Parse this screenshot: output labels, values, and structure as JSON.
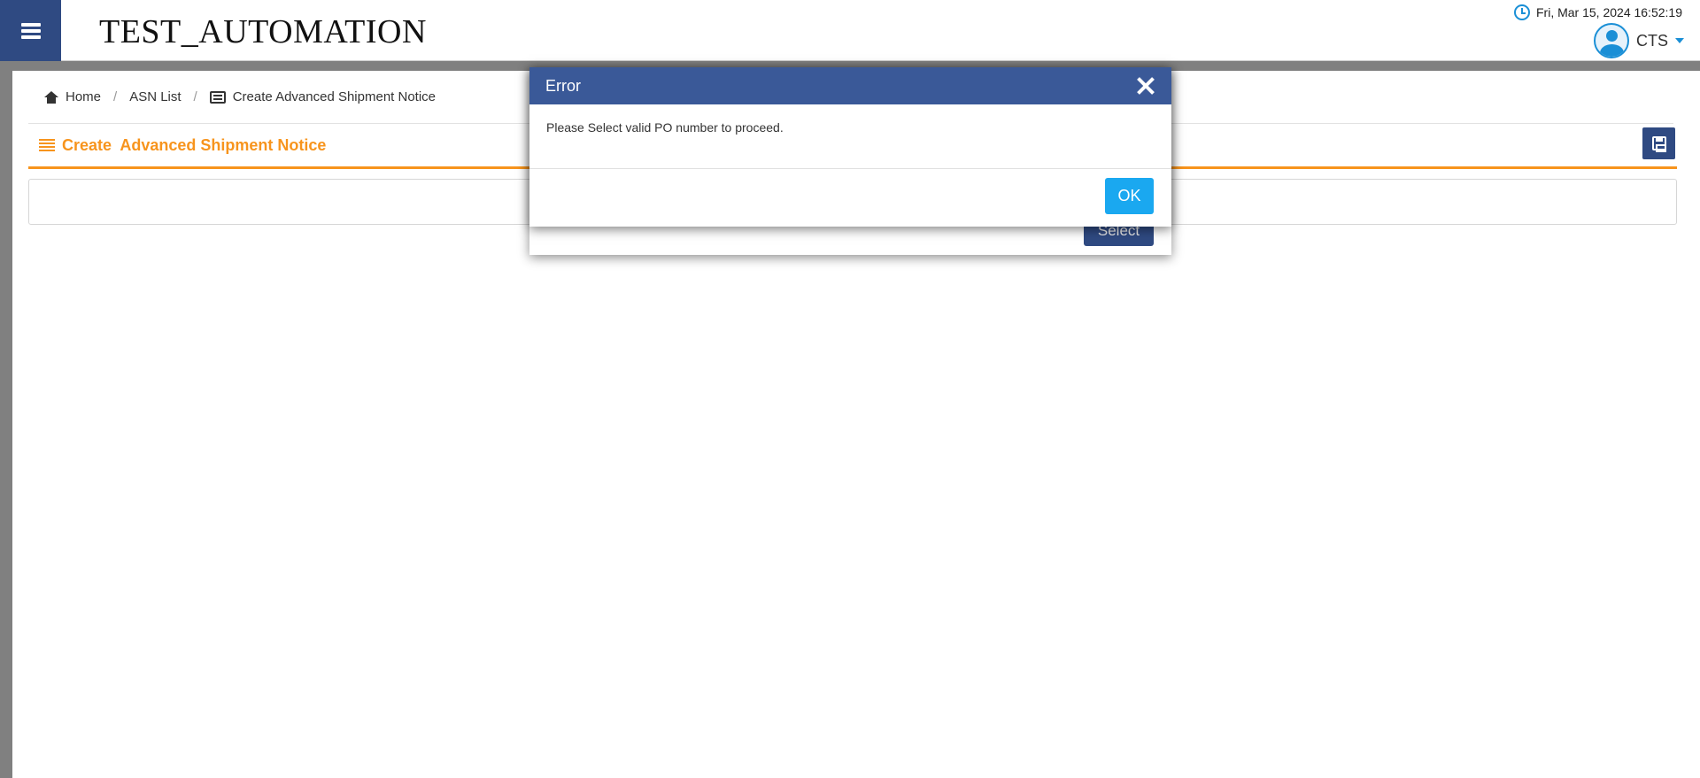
{
  "header": {
    "app_title": "TEST_AUTOMATION",
    "datetime": "Fri, Mar 15, 2024 16:52:19",
    "user_name": "CTS"
  },
  "breadcrumb": {
    "home": "Home",
    "asn_list": "ASN List",
    "current": "Create Advanced Shipment Notice"
  },
  "section": {
    "title": "Create  Advanced Shipment Notice"
  },
  "background_modal": {
    "select_label": "Select"
  },
  "error_modal": {
    "title": "Error",
    "message": "Please Select valid PO number to proceed.",
    "ok_label": "OK"
  },
  "colors": {
    "brand_blue": "#2f4a82",
    "modal_header": "#3a5998",
    "accent_orange": "#f7941d",
    "ok_blue": "#1aa8f0"
  }
}
